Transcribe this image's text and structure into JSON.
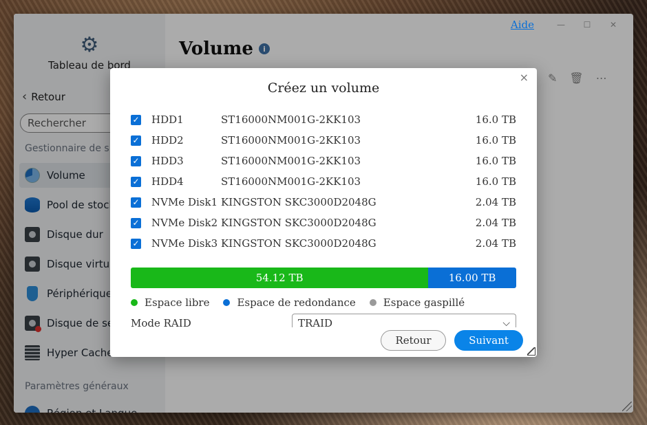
{
  "window": {
    "help_link": "Aide",
    "min_icon": "minimize-icon",
    "max_icon": "maximize-icon",
    "close_icon": "close-icon"
  },
  "sidebar": {
    "header_label": "Tableau de bord",
    "back_label": "Retour",
    "search_placeholder": "Rechercher",
    "section_storage": "Gestionnaire de s",
    "items": [
      {
        "label": "Volume",
        "icon": "volume-pie-icon",
        "active": true
      },
      {
        "label": "Pool de stock",
        "icon": "storage-pool-icon"
      },
      {
        "label": "Disque dur",
        "icon": "hard-disk-icon"
      },
      {
        "label": "Disque virtu",
        "icon": "virtual-disk-icon"
      },
      {
        "label": "Périphérique",
        "icon": "usb-device-icon"
      },
      {
        "label": "Disque de se",
        "icon": "spare-disk-icon"
      },
      {
        "label": "Hyper Cache",
        "icon": "hyper-cache-icon"
      }
    ],
    "section_general": "Paramètres généraux",
    "partial_item": "Région et Langue"
  },
  "main": {
    "title": "Volume",
    "info_icon": "info-icon",
    "toolbar_icons": [
      "edit-icon",
      "delete-icon",
      "more-icon"
    ]
  },
  "dialog": {
    "title": "Créez un volume",
    "disks": [
      {
        "name": "HDD1",
        "model": "ST16000NM001G-2KK103",
        "size": "16.0 TB",
        "checked": true
      },
      {
        "name": "HDD2",
        "model": "ST16000NM001G-2KK103",
        "size": "16.0 TB",
        "checked": true
      },
      {
        "name": "HDD3",
        "model": "ST16000NM001G-2KK103",
        "size": "16.0 TB",
        "checked": true
      },
      {
        "name": "HDD4",
        "model": "ST16000NM001G-2KK103",
        "size": "16.0 TB",
        "checked": true
      },
      {
        "name": "NVMe Disk1",
        "model": "KINGSTON SKC3000D2048G",
        "size": "2.04 TB",
        "checked": true
      },
      {
        "name": "NVMe Disk2",
        "model": "KINGSTON SKC3000D2048G",
        "size": "2.04 TB",
        "checked": true
      },
      {
        "name": "NVMe Disk3",
        "model": "KINGSTON SKC3000D2048G",
        "size": "2.04 TB",
        "checked": true
      }
    ],
    "capacity": {
      "free_label": "54.12 TB",
      "free_value_tb": 54.12,
      "redundancy_label": "16.00 TB",
      "redundancy_value_tb": 16.0
    },
    "legend": [
      {
        "label": "Espace libre",
        "color": "#19b819"
      },
      {
        "label": "Espace de redondance",
        "color": "#0a6fd6"
      },
      {
        "label": "Espace gaspillé",
        "color": "#9a9a9a"
      }
    ],
    "raid_label": "Mode RAID",
    "raid_value": "TRAID",
    "back_button": "Retour",
    "next_button": "Suivant"
  },
  "colors": {
    "accent": "#0a84e8",
    "free": "#19b819",
    "redundancy": "#0a6fd6"
  }
}
